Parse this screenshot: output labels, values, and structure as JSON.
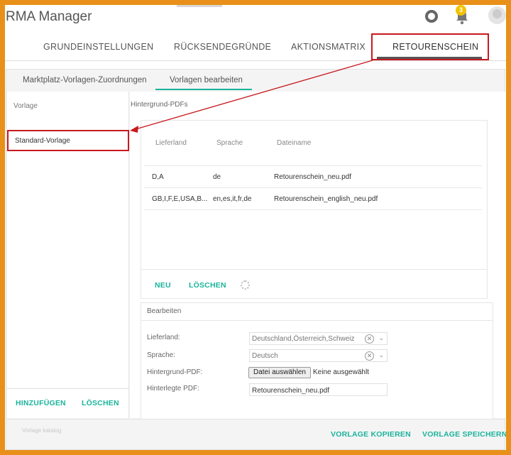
{
  "app": {
    "title": "RMA Manager",
    "notification_count": "3"
  },
  "main_tabs": [
    {
      "label": "GRUNDEINSTELLUNGEN"
    },
    {
      "label": "RÜCKSENDEGRÜNDE"
    },
    {
      "label": "AKTIONSMATRIX"
    },
    {
      "label": "RETOURENSCHEIN"
    }
  ],
  "sub_tabs": [
    {
      "label": "Marktplatz-Vorlagen-Zuordnungen"
    },
    {
      "label": "Vorlagen bearbeiten"
    }
  ],
  "sidebar": {
    "heading": "Vorlage",
    "items": [
      {
        "label": "Standard-Vorlage"
      }
    ],
    "add_button": "HINZUFÜGEN",
    "delete_button": "LÖSCHEN",
    "faint_text": "Vorlage katalog"
  },
  "pdfs": {
    "heading": "Hintergrund-PDFs",
    "columns": [
      "Lieferland",
      "Sprache",
      "Dateiname"
    ],
    "rows": [
      [
        "D,A",
        "de",
        "Retourenschein_neu.pdf"
      ],
      [
        "GB,I,F,E,USA,B...",
        "en,es,it,fr,de",
        "Retourenschein_english_neu.pdf"
      ]
    ],
    "new_button": "NEU",
    "delete_button": "LÖSCHEN"
  },
  "edit": {
    "heading": "Bearbeiten",
    "lieferland_label": "Lieferland:",
    "lieferland_value": "Deutschland,Österreich,Schweiz",
    "sprache_label": "Sprache:",
    "sprache_value": "Deutsch",
    "hintergrund_label": "Hintergrund-PDF:",
    "file_button": "Datei auswählen",
    "file_status": "Keine ausgewählt",
    "hinterlegte_label": "Hinterlegte PDF:",
    "hinterlegte_value": "Retourenschein_neu.pdf"
  },
  "footer": {
    "copy_button": "VORLAGE KOPIEREN",
    "save_button": "VORLAGE SPEICHERN"
  },
  "colors": {
    "accent": "#1bb39c",
    "highlight": "#c8181e",
    "frame": "#e8901a"
  }
}
